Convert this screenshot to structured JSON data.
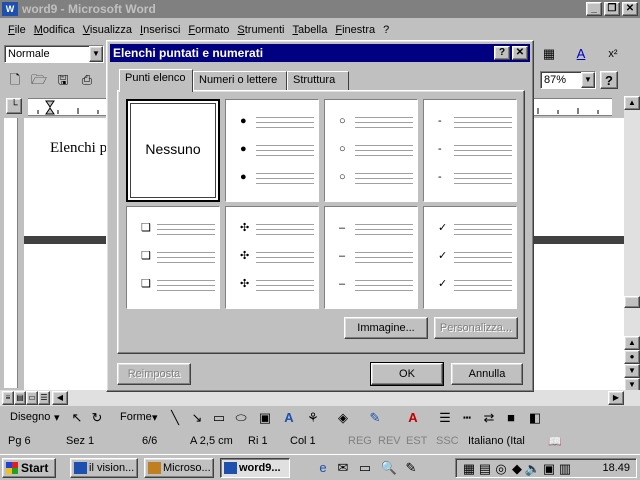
{
  "window": {
    "title": "word9 - Microsoft Word",
    "app_icon": "W"
  },
  "menu": [
    "File",
    "Modifica",
    "Visualizza",
    "Inserisci",
    "Formato",
    "Strumenti",
    "Tabella",
    "Finestra",
    "?"
  ],
  "toolbar": {
    "style_value": "Normale",
    "zoom_value": "87%"
  },
  "document": {
    "text": "Elenchi p"
  },
  "drawing_toolbar": {
    "draw_label": "Disegno",
    "shapes_label": "Forme"
  },
  "status": {
    "page": "Pg 6",
    "section": "Sez 1",
    "pages": "6/6",
    "at": "A  2,5 cm",
    "line": "Ri  1",
    "col": "Col  1",
    "rec": "REG",
    "rev": "REV",
    "ext": "EST",
    "ovr": "SSC",
    "language": "Italiano (Ital"
  },
  "taskbar": {
    "start_label": "Start",
    "tasks": [
      "il vision...",
      "Microso...",
      "word9..."
    ],
    "clock": "18.49"
  },
  "dialog": {
    "title": "Elenchi puntati e numerati",
    "tabs": [
      "Punti elenco",
      "Numeri o lettere",
      "Struttura"
    ],
    "none_label": "Nessuno",
    "bullet_styles": [
      {
        "symbol": "●"
      },
      {
        "symbol": "○"
      },
      {
        "symbol": "-"
      },
      {
        "symbol": "❑"
      },
      {
        "symbol": "✣"
      },
      {
        "symbol": "–"
      },
      {
        "symbol": "✓"
      }
    ],
    "buttons": {
      "picture": "Immagine...",
      "customize": "Personalizza...",
      "reset": "Reimposta",
      "ok": "OK",
      "cancel": "Annulla"
    }
  }
}
